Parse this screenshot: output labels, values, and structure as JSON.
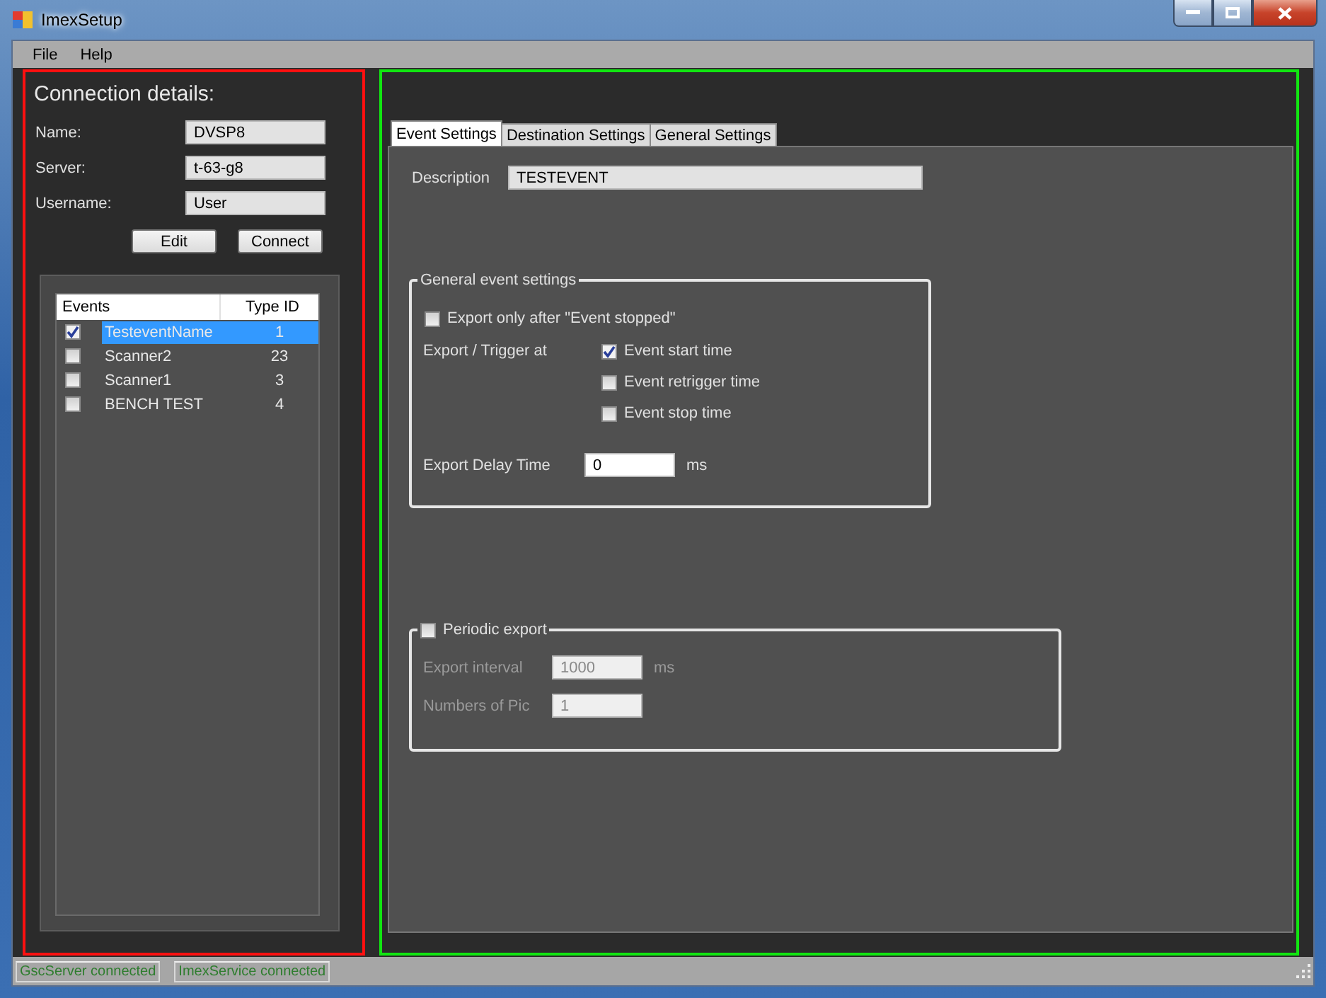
{
  "window": {
    "title": "ImexSetup"
  },
  "menu": [
    "File",
    "Help"
  ],
  "connection": {
    "heading": "Connection details:",
    "fields": [
      {
        "label": "Name:",
        "value": "DVSP8"
      },
      {
        "label": "Server:",
        "value": "t-63-g8"
      },
      {
        "label": "Username:",
        "value": "User"
      }
    ],
    "buttons": [
      "Edit",
      "Connect"
    ]
  },
  "events": {
    "columns": [
      "Events",
      "Type ID"
    ],
    "rows": [
      {
        "name": "TesteventName",
        "type_id": "1",
        "checked": true,
        "selected": true
      },
      {
        "name": "Scanner2",
        "type_id": "23",
        "checked": false,
        "selected": false
      },
      {
        "name": "Scanner1",
        "type_id": "3",
        "checked": false,
        "selected": false
      },
      {
        "name": "BENCH TEST",
        "type_id": "4",
        "checked": false,
        "selected": false
      }
    ]
  },
  "tabs": [
    {
      "label": "Event Settings",
      "selected": true
    },
    {
      "label": "Destination Settings",
      "selected": false
    },
    {
      "label": "General Settings",
      "selected": false
    }
  ],
  "description": {
    "label": "Description",
    "value": "TESTEVENT"
  },
  "general_group": {
    "title": "General event settings",
    "export_only": {
      "label": "Export only after \"Event stopped\"",
      "checked": false
    },
    "trigger_label": "Export / Trigger at",
    "triggers": [
      {
        "label": "Event start time",
        "checked": true
      },
      {
        "label": "Event retrigger time",
        "checked": false
      },
      {
        "label": "Event stop time",
        "checked": false
      }
    ],
    "delay": {
      "label": "Export Delay Time",
      "value": "0",
      "unit": "ms"
    }
  },
  "periodic_group": {
    "title": "Periodic export",
    "checked": false,
    "disabled": true,
    "interval": {
      "label": "Export interval",
      "value": "1000",
      "unit": "ms"
    },
    "count": {
      "label": "Numbers of Pic",
      "value": "1"
    }
  },
  "status_bar": [
    "GscServer connected",
    "ImexService connected"
  ]
}
